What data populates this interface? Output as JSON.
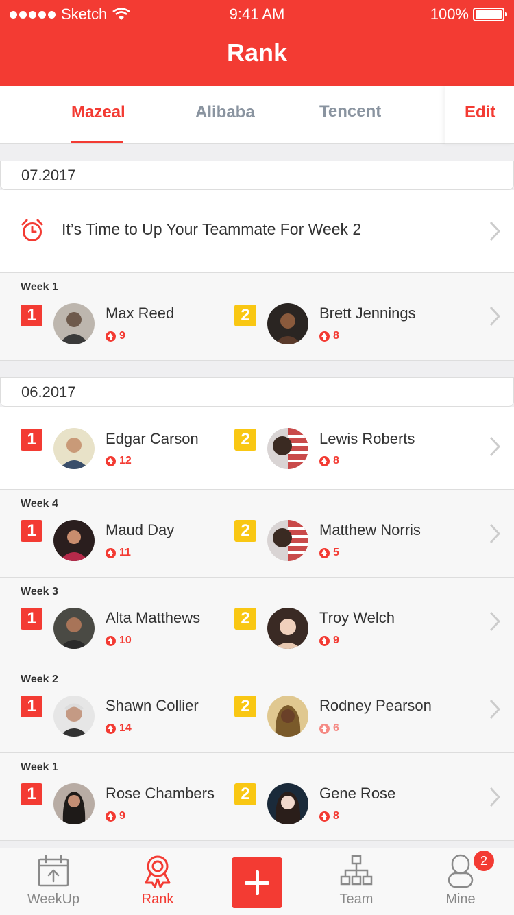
{
  "status_bar": {
    "carrier": "Sketch",
    "time": "9:41 AM",
    "battery": "100%"
  },
  "header": {
    "title": "Rank"
  },
  "tabs": [
    {
      "label": "Mazeal",
      "active": true
    },
    {
      "label": "Alibaba",
      "active": false
    },
    {
      "label": "Tencent",
      "active": false
    }
  ],
  "edit_label": "Edit",
  "months": [
    "07.2017",
    "06.2017"
  ],
  "reminder": {
    "text": "It’s Time to Up Your Teammate  For Week 2"
  },
  "groups": [
    {
      "week": "Week 1",
      "first": {
        "rank": "1",
        "name": "Max Reed",
        "score": "9"
      },
      "second": {
        "rank": "2",
        "name": "Brett Jennings",
        "score": "8"
      }
    },
    {
      "week": "",
      "first": {
        "rank": "1",
        "name": "Edgar Carson",
        "score": "12"
      },
      "second": {
        "rank": "2",
        "name": "Lewis Roberts",
        "score": "8"
      }
    },
    {
      "week": "Week 4",
      "first": {
        "rank": "1",
        "name": "Maud Day",
        "score": "11"
      },
      "second": {
        "rank": "2",
        "name": "Matthew Norris",
        "score": "5"
      }
    },
    {
      "week": "Week 3",
      "first": {
        "rank": "1",
        "name": "Alta Matthews",
        "score": "10"
      },
      "second": {
        "rank": "2",
        "name": "Troy Welch",
        "score": "9"
      }
    },
    {
      "week": "Week 2",
      "first": {
        "rank": "1",
        "name": "Shawn Collier",
        "score": "14"
      },
      "second": {
        "rank": "2",
        "name": "Rodney Pearson",
        "score": "6"
      }
    },
    {
      "week": "Week 1",
      "first": {
        "rank": "1",
        "name": "Rose Chambers",
        "score": "9"
      },
      "second": {
        "rank": "2",
        "name": "Gene Rose",
        "score": "8"
      }
    }
  ],
  "tabbar": {
    "items": [
      {
        "label": "WeekUp",
        "icon": "weekup-icon"
      },
      {
        "label": "Rank",
        "icon": "medal-icon",
        "active": true
      },
      {
        "label": "",
        "icon": "plus-icon"
      },
      {
        "label": "Team",
        "icon": "team-icon"
      },
      {
        "label": "Mine",
        "icon": "person-icon"
      }
    ],
    "mine_badge": "2"
  },
  "colors": {
    "accent": "#f33b33",
    "rank_one": "#f33b33",
    "rank_two": "#f9c713",
    "inactive": "#8a94a0"
  }
}
